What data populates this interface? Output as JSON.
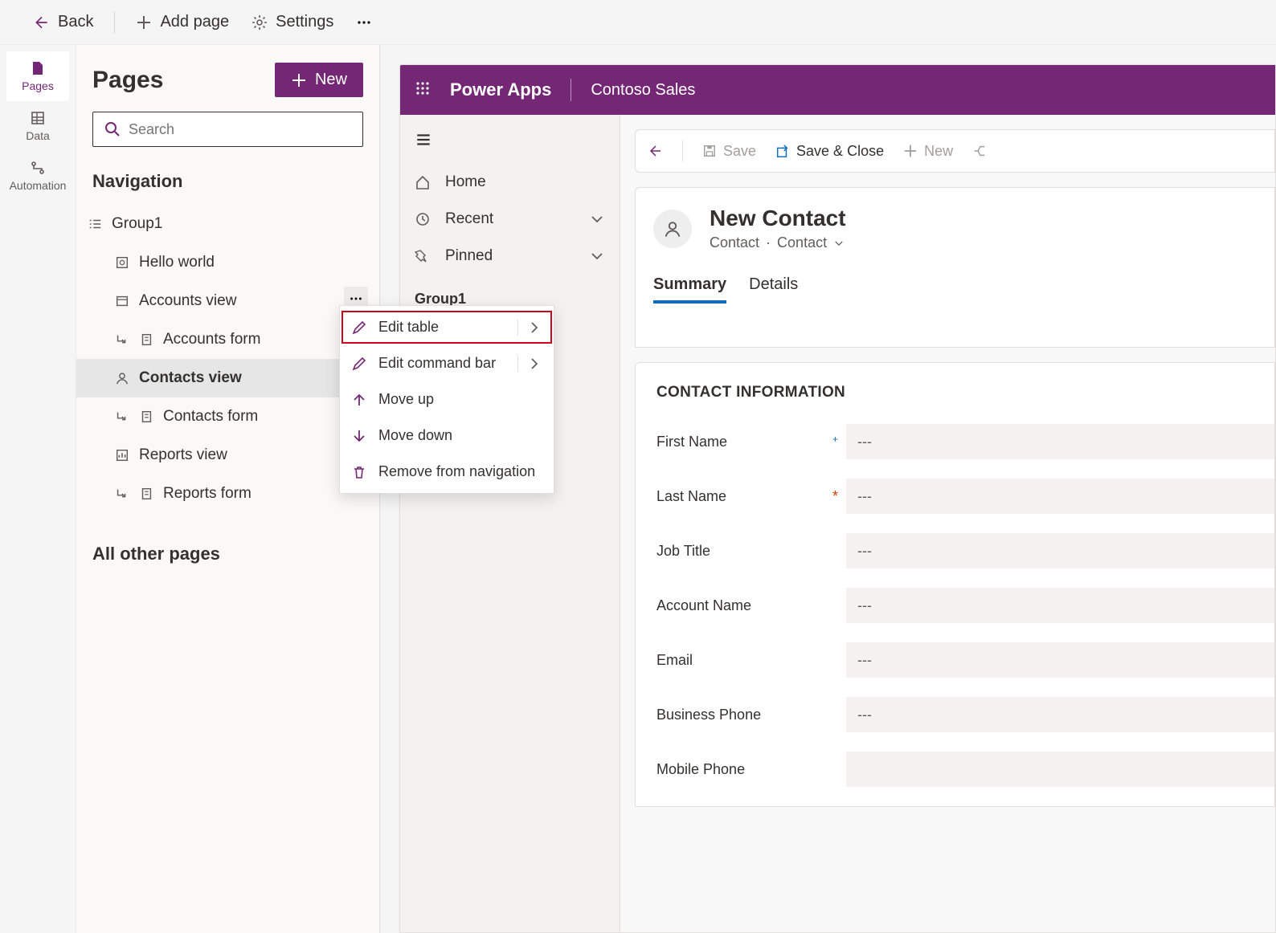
{
  "toolbar": {
    "back": "Back",
    "add_page": "Add page",
    "settings": "Settings"
  },
  "rail": {
    "pages": "Pages",
    "data": "Data",
    "automation": "Automation"
  },
  "pages_panel": {
    "title": "Pages",
    "new_label": "New",
    "search_placeholder": "Search",
    "navigation_heading": "Navigation",
    "group_label": "Group1",
    "items": [
      {
        "label": "Hello world",
        "icon": "dashboard"
      },
      {
        "label": "Accounts view",
        "icon": "view"
      },
      {
        "label": "Accounts form",
        "icon": "form",
        "sub": true
      },
      {
        "label": "Contacts view",
        "icon": "view",
        "selected": true
      },
      {
        "label": "Contacts form",
        "icon": "form",
        "sub": true
      },
      {
        "label": "Reports view",
        "icon": "chart"
      },
      {
        "label": "Reports form",
        "icon": "form",
        "sub": true
      }
    ],
    "all_other": "All other pages"
  },
  "context_menu": {
    "items": [
      {
        "label": "Edit table",
        "icon": "pencil",
        "chevron": true,
        "highlight": true
      },
      {
        "label": "Edit command bar",
        "icon": "pencil",
        "chevron": true
      },
      {
        "label": "Move up",
        "icon": "arrow-up"
      },
      {
        "label": "Move down",
        "icon": "arrow-down"
      },
      {
        "label": "Remove from navigation",
        "icon": "trash"
      }
    ]
  },
  "app": {
    "brand": "Power Apps",
    "name": "Contoso Sales",
    "nav": {
      "home": "Home",
      "recent": "Recent",
      "pinned": "Pinned",
      "group": "Group1"
    },
    "commands": {
      "save": "Save",
      "save_close": "Save & Close",
      "new": "New"
    },
    "form": {
      "title": "New Contact",
      "entity": "Contact",
      "view": "Contact",
      "tabs": {
        "summary": "Summary",
        "details": "Details"
      },
      "section": "CONTACT INFORMATION",
      "fields": [
        {
          "label": "First Name",
          "value": "---",
          "req": "blue"
        },
        {
          "label": "Last Name",
          "value": "---",
          "req": "red"
        },
        {
          "label": "Job Title",
          "value": "---"
        },
        {
          "label": "Account Name",
          "value": "---"
        },
        {
          "label": "Email",
          "value": "---"
        },
        {
          "label": "Business Phone",
          "value": "---"
        },
        {
          "label": "Mobile Phone",
          "value": ""
        }
      ]
    }
  }
}
